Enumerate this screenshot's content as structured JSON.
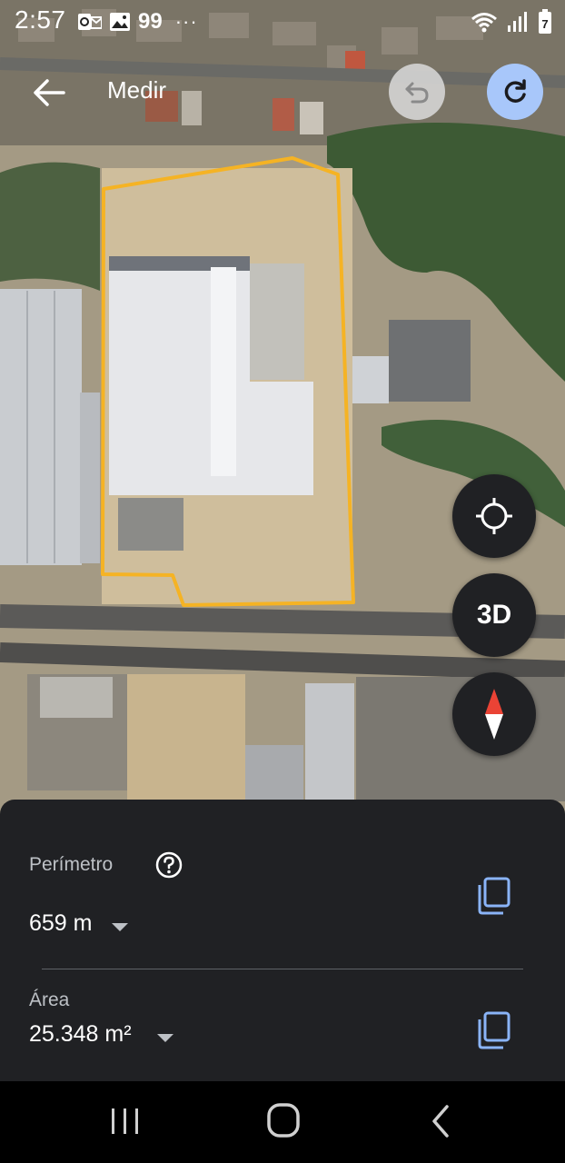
{
  "status_bar": {
    "time": "2:57",
    "notification_count": "99",
    "more_indicator": "···",
    "battery_level": "7"
  },
  "toolbar": {
    "title": "Medir"
  },
  "map": {
    "view_toggle_label": "3D",
    "measurement_outline_color": "#f5b324",
    "compass_needle_color": "#ea4335"
  },
  "measurement": {
    "perimeter_label": "Perímetro",
    "perimeter_value": "659 m",
    "area_label": "Área",
    "area_value": "25.348 m²"
  },
  "colors": {
    "redo_button": "#a8c7fa",
    "copy_icon": "#8ab4f8",
    "sheet_background": "#202124"
  }
}
